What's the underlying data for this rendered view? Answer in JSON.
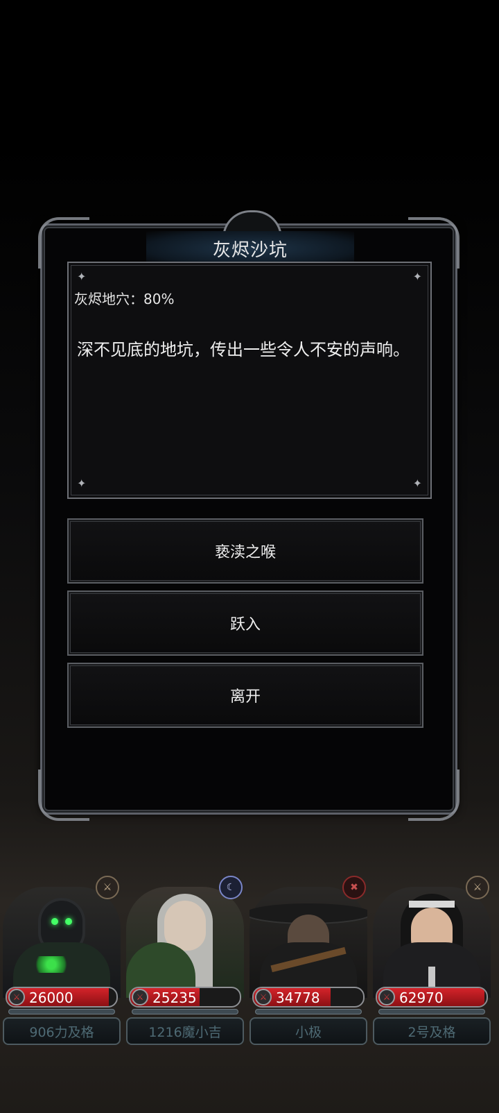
{
  "dialog": {
    "title": "灰烬沙坑",
    "location": "灰烬地穴：80%",
    "description": "深不见底的地坑，传出一些令人不安的声响。",
    "choices": [
      "亵渎之喉",
      "跃入",
      "离开"
    ]
  },
  "party": [
    {
      "hp": "26000",
      "hp_fraction": 0.93,
      "name": "906力及格",
      "class_icon": "beast-emblem-icon"
    },
    {
      "hp": "25235",
      "hp_fraction": 0.63,
      "name": "1216魔小吉",
      "class_icon": "mage-emblem-icon"
    },
    {
      "hp": "34778",
      "hp_fraction": 0.7,
      "name": "小极",
      "class_icon": "rogue-emblem-icon"
    },
    {
      "hp": "62970",
      "hp_fraction": 0.98,
      "name": "2号及格",
      "class_icon": "beast-emblem-icon"
    }
  ],
  "colors": {
    "hp_red": "#d4232a",
    "frame_steel": "#5c6068",
    "title_glow": "#1e3448",
    "name_text": "#4e6a74"
  }
}
